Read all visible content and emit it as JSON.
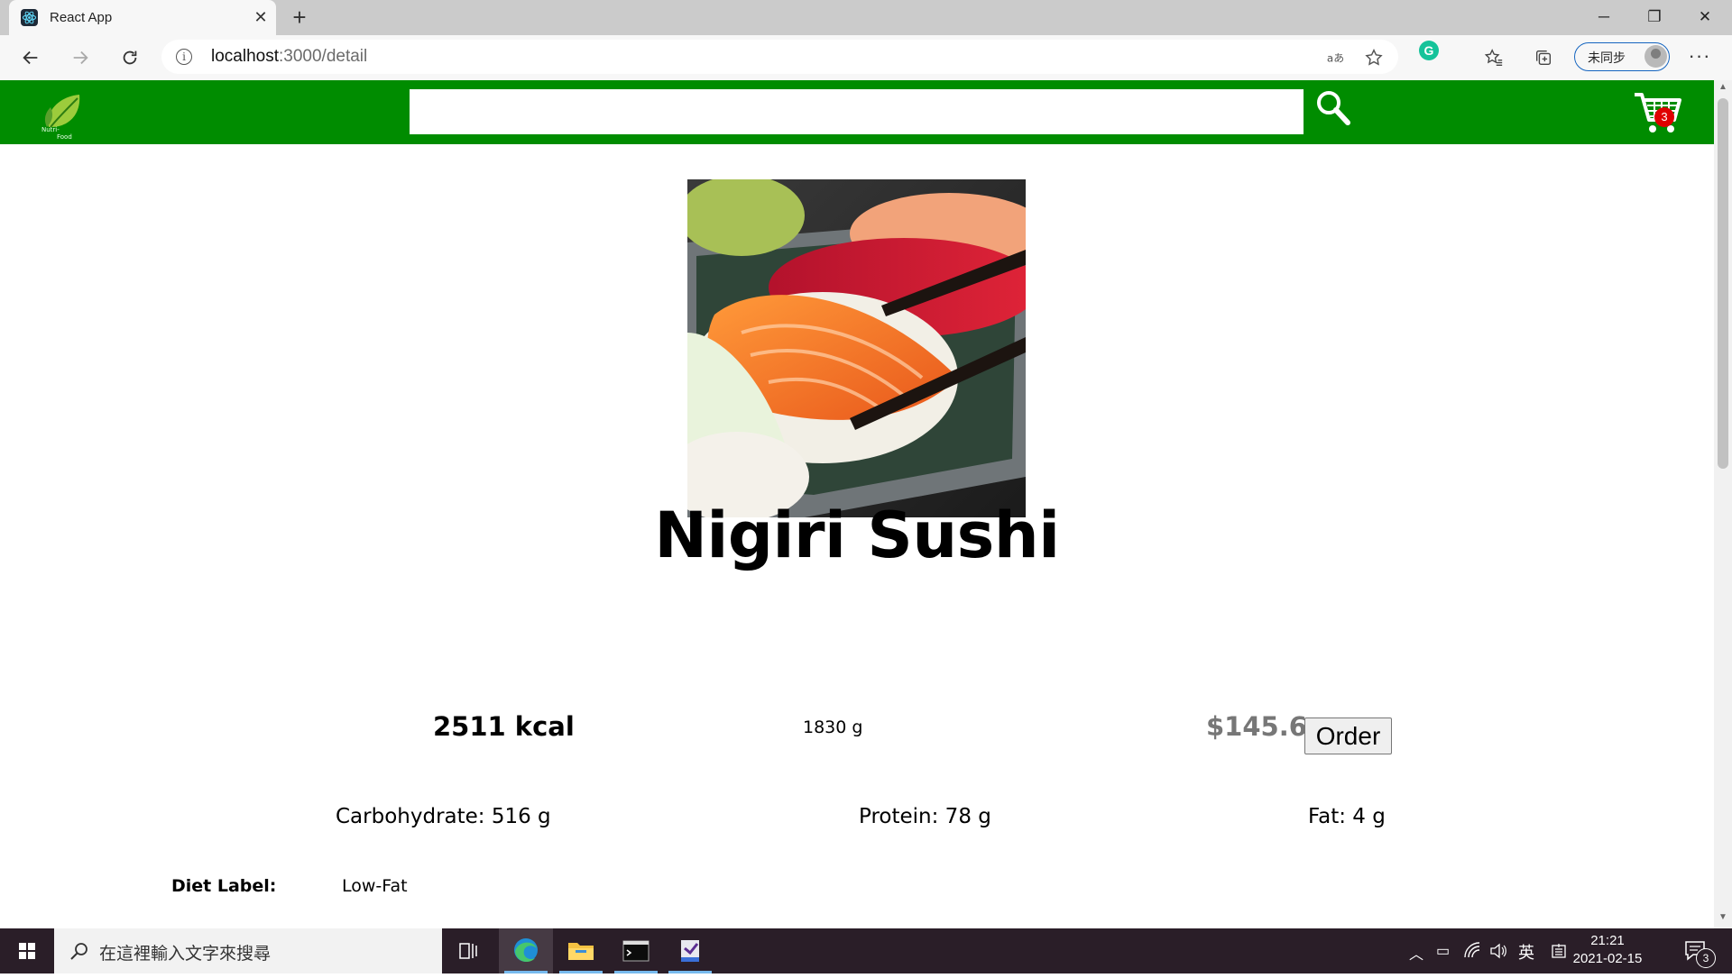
{
  "browser": {
    "tab_title": "React App",
    "tab_close_glyph": "✕",
    "new_tab_glyph": "+",
    "url_host": "localhost",
    "url_path": ":3000/detail",
    "profile_label": "未同步",
    "more_glyph": "···",
    "window_controls": [
      "─",
      "❐",
      "✕"
    ]
  },
  "app": {
    "cart_count": "3",
    "search_value": ""
  },
  "product": {
    "name": "Nigiri Sushi",
    "calories": "2511 kcal",
    "weight": "1830 g",
    "price": "$145.6",
    "order_label": "Order",
    "carbohydrate": "Carbohydrate: 516 g",
    "protein": "Protein: 78 g",
    "fat": "Fat: 4 g",
    "diet_label_key": "Diet Label:",
    "diet_label_value": "Low-Fat"
  },
  "taskbar": {
    "search_placeholder": "在這裡輸入文字來搜尋",
    "ime": "英",
    "time": "21:21",
    "date": "2021-02-15",
    "notification_count": "3"
  },
  "colors": {
    "header_green": "#008c00",
    "badge_red": "#e00000",
    "price_gray": "#777777"
  }
}
